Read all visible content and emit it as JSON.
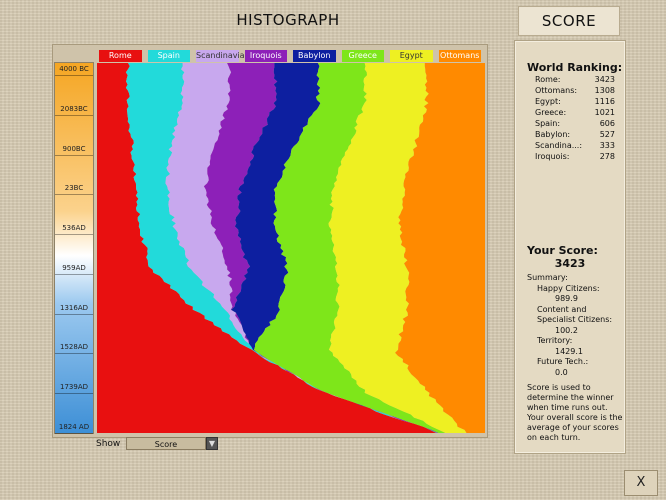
{
  "header": {
    "histograph_title": "HISTOGRAPH",
    "score_title": "SCORE"
  },
  "legend": [
    {
      "name": "Rome",
      "color": "#e81010",
      "text_color": "#ffffff"
    },
    {
      "name": "Spain",
      "color": "#22dada",
      "text_color": "#ffffff"
    },
    {
      "name": "Scandinavia",
      "color": "#c8a8ee",
      "text_color": "#333333"
    },
    {
      "name": "Iroquois",
      "color": "#8d20b8",
      "text_color": "#ffffff"
    },
    {
      "name": "Babylon",
      "color": "#0d1fa0",
      "text_color": "#ffffff"
    },
    {
      "name": "Greece",
      "color": "#7ee61a",
      "text_color": "#ffffff"
    },
    {
      "name": "Egypt",
      "color": "#eef022",
      "text_color": "#333333"
    },
    {
      "name": "Ottomans",
      "color": "#ff8a00",
      "text_color": "#ffffff"
    }
  ],
  "year_scale": [
    "4000 BC",
    "2083BC",
    "900BC",
    "23BC",
    "536AD",
    "959AD",
    "1316AD",
    "1528AD",
    "1739AD",
    "1824 AD"
  ],
  "show": {
    "label": "Show",
    "selected": "Score"
  },
  "chart_data": {
    "type": "area",
    "stacked_proportional": true,
    "series": [
      {
        "name": "Rome",
        "values": [
          0.08,
          0.08,
          0.09,
          0.1,
          0.11,
          0.14,
          0.25,
          0.4,
          0.58,
          0.88
        ]
      },
      {
        "name": "Spain",
        "values": [
          0.14,
          0.14,
          0.1,
          0.08,
          0.09,
          0.1,
          0.08,
          0.0,
          0.0,
          0.0
        ]
      },
      {
        "name": "Scandinavia",
        "values": [
          0.12,
          0.12,
          0.11,
          0.1,
          0.1,
          0.1,
          0.02,
          0.0,
          0.0,
          0.0
        ]
      },
      {
        "name": "Iroquois",
        "values": [
          0.12,
          0.12,
          0.11,
          0.09,
          0.06,
          0.05,
          0.0,
          0.0,
          0.0,
          0.0
        ]
      },
      {
        "name": "Babylon",
        "values": [
          0.11,
          0.11,
          0.1,
          0.09,
          0.1,
          0.1,
          0.12,
          0.0,
          0.0,
          0.0
        ]
      },
      {
        "name": "Greece",
        "values": [
          0.12,
          0.12,
          0.14,
          0.15,
          0.14,
          0.13,
          0.15,
          0.2,
          0.11,
          0.02
        ]
      },
      {
        "name": "Egypt",
        "values": [
          0.16,
          0.16,
          0.17,
          0.18,
          0.18,
          0.18,
          0.18,
          0.17,
          0.16,
          0.05
        ]
      },
      {
        "name": "Ottomans",
        "values": [
          0.15,
          0.15,
          0.18,
          0.21,
          0.22,
          0.2,
          0.2,
          0.23,
          0.15,
          0.05
        ]
      }
    ]
  },
  "ranking": {
    "heading": "World Ranking:",
    "rows": [
      {
        "name": "Rome:",
        "score": "3423"
      },
      {
        "name": "Ottomans:",
        "score": "1308"
      },
      {
        "name": "Egypt:",
        "score": "1116"
      },
      {
        "name": "Greece:",
        "score": "1021"
      },
      {
        "name": "Spain:",
        "score": "606"
      },
      {
        "name": "Babylon:",
        "score": "527"
      },
      {
        "name": "Scandina...:",
        "score": "333"
      },
      {
        "name": "Iroquois:",
        "score": "278"
      }
    ]
  },
  "your_score": {
    "label": "Your Score:",
    "value": "3423",
    "summary_label": "Summary:",
    "happy_label": "Happy Citizens:",
    "happy_value": "989.9",
    "content_label": "Content and Specialist Citizens:",
    "content_value": "100.2",
    "territory_label": "Territory:",
    "territory_value": "1429.1",
    "future_label": "Future Tech.:",
    "future_value": "0.0"
  },
  "note": "Score is used to determine the winner when time runs out. Your overall score is the average of your scores on each turn.",
  "close_label": "X"
}
